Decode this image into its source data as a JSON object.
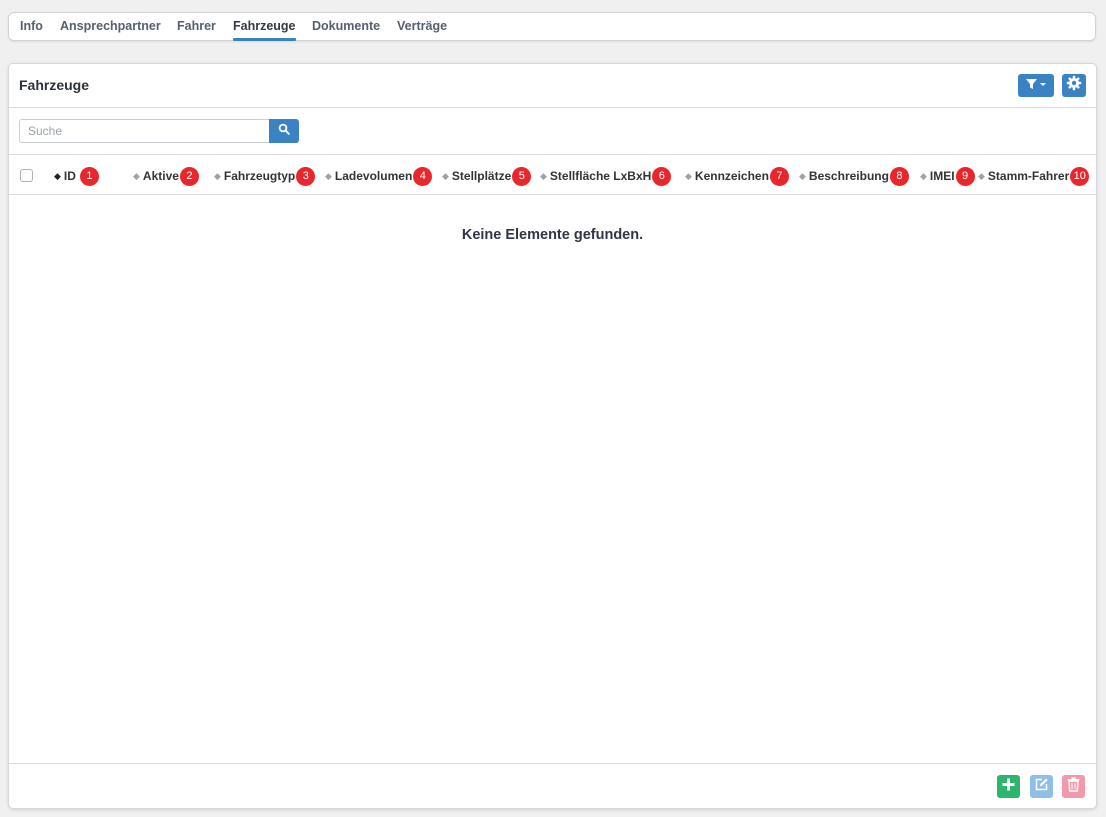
{
  "tabs": [
    {
      "label": "Info",
      "active": false
    },
    {
      "label": "Ansprechpartner",
      "active": false
    },
    {
      "label": "Fahrer",
      "active": false
    },
    {
      "label": "Fahrzeuge",
      "active": true
    },
    {
      "label": "Dokumente",
      "active": false
    },
    {
      "label": "Verträge",
      "active": false
    }
  ],
  "panel": {
    "title": "Fahrzeuge",
    "filter_icon": "filter-dropdown-icon",
    "settings_icon": "gear-icon"
  },
  "search": {
    "placeholder": "Suche",
    "value": "",
    "button_icon": "search-icon"
  },
  "table": {
    "columns": [
      {
        "label": "ID",
        "badge": "1",
        "sorted": true
      },
      {
        "label": "Aktive",
        "badge": "2",
        "sorted": false
      },
      {
        "label": "Fahrzeugtyp",
        "badge": "3",
        "sorted": false
      },
      {
        "label": "Ladevolumen",
        "badge": "4",
        "sorted": false
      },
      {
        "label": "Stellplätze",
        "badge": "5",
        "sorted": false
      },
      {
        "label": "Stellfläche LxBxH",
        "badge": "6",
        "sorted": false
      },
      {
        "label": "Kennzeichen",
        "badge": "7",
        "sorted": false
      },
      {
        "label": "Beschreibung",
        "badge": "8",
        "sorted": false
      },
      {
        "label": "IMEI",
        "badge": "9",
        "sorted": false
      },
      {
        "label": "Stamm-Fahrer",
        "badge": "10",
        "sorted": false
      }
    ],
    "empty_message": "Keine Elemente gefunden."
  },
  "footer": {
    "add_icon": "plus-icon",
    "edit_icon": "edit-icon",
    "delete_icon": "trash-icon",
    "colors": {
      "add": "#2db56c",
      "edit": "#8fbfe6",
      "delete": "#f29aab"
    }
  },
  "colors": {
    "accent": "#3b82c4",
    "badge": "#e8262c"
  }
}
